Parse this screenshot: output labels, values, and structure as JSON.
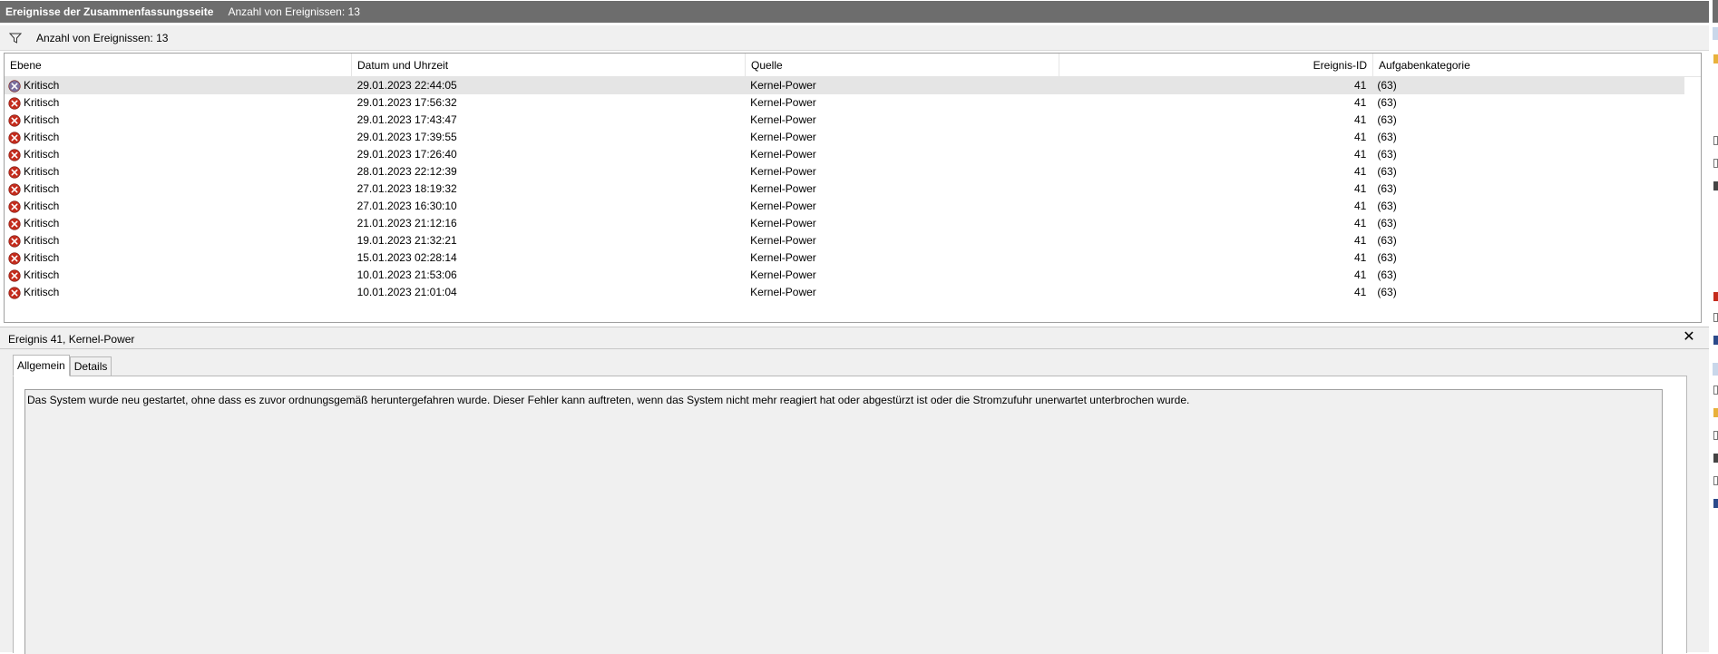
{
  "title_bar": {
    "title": "Ereignisse der Zusammenfassungsseite",
    "event_count": "Anzahl von Ereignissen: 13"
  },
  "filter_bar": {
    "icon": "filter-icon",
    "event_count": "Anzahl von Ereignissen: 13"
  },
  "table": {
    "columns": [
      "Ebene",
      "Datum und Uhrzeit",
      "Quelle",
      "Ereignis-ID",
      "Aufgabenkategorie"
    ],
    "rows": [
      {
        "ebene": "Kritisch",
        "datum": "29.01.2023 22:44:05",
        "quelle": "Kernel-Power",
        "id": "41",
        "kategorie": "(63)"
      },
      {
        "ebene": "Kritisch",
        "datum": "29.01.2023 17:56:32",
        "quelle": "Kernel-Power",
        "id": "41",
        "kategorie": "(63)"
      },
      {
        "ebene": "Kritisch",
        "datum": "29.01.2023 17:43:47",
        "quelle": "Kernel-Power",
        "id": "41",
        "kategorie": "(63)"
      },
      {
        "ebene": "Kritisch",
        "datum": "29.01.2023 17:39:55",
        "quelle": "Kernel-Power",
        "id": "41",
        "kategorie": "(63)"
      },
      {
        "ebene": "Kritisch",
        "datum": "29.01.2023 17:26:40",
        "quelle": "Kernel-Power",
        "id": "41",
        "kategorie": "(63)"
      },
      {
        "ebene": "Kritisch",
        "datum": "28.01.2023 22:12:39",
        "quelle": "Kernel-Power",
        "id": "41",
        "kategorie": "(63)"
      },
      {
        "ebene": "Kritisch",
        "datum": "27.01.2023 18:19:32",
        "quelle": "Kernel-Power",
        "id": "41",
        "kategorie": "(63)"
      },
      {
        "ebene": "Kritisch",
        "datum": "27.01.2023 16:30:10",
        "quelle": "Kernel-Power",
        "id": "41",
        "kategorie": "(63)"
      },
      {
        "ebene": "Kritisch",
        "datum": "21.01.2023 21:12:16",
        "quelle": "Kernel-Power",
        "id": "41",
        "kategorie": "(63)"
      },
      {
        "ebene": "Kritisch",
        "datum": "19.01.2023 21:32:21",
        "quelle": "Kernel-Power",
        "id": "41",
        "kategorie": "(63)"
      },
      {
        "ebene": "Kritisch",
        "datum": "15.01.2023 02:28:14",
        "quelle": "Kernel-Power",
        "id": "41",
        "kategorie": "(63)"
      },
      {
        "ebene": "Kritisch",
        "datum": "10.01.2023 21:53:06",
        "quelle": "Kernel-Power",
        "id": "41",
        "kategorie": "(63)"
      },
      {
        "ebene": "Kritisch",
        "datum": "10.01.2023 21:01:04",
        "quelle": "Kernel-Power",
        "id": "41",
        "kategorie": "(63)"
      }
    ],
    "selected_row": 0,
    "row_icon": "critical-error-icon"
  },
  "detail": {
    "title": "Ereignis 41, Kernel-Power",
    "close_icon": "close-icon",
    "tabs": [
      "Allgemein",
      "Details"
    ],
    "active_tab": "Allgemein",
    "description": "Das System wurde neu gestartet, ohne dass es zuvor ordnungsgemäß heruntergefahren wurde. Dieser Fehler kann auftreten, wenn das System nicht mehr reagiert hat oder abgestürzt ist oder die Stromzufuhr unerwartet unterbrochen wurde."
  },
  "colors": {
    "title_bar_bg": "#6d6d6d",
    "panel_bg": "#f0f0f0",
    "critical_red": "#c42b1c",
    "selected_row_bg": "#e5e5e5"
  }
}
